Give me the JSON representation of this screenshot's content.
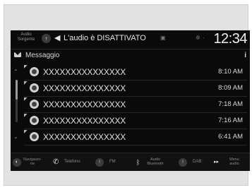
{
  "status_bar": {
    "source_label_line1": "Audio",
    "source_label_line2": "Sorgente",
    "audio_status": "L'audio è DISATTIVATO",
    "clock": "12:34"
  },
  "header": {
    "title": "Messaggio",
    "info_glyph": "i"
  },
  "messages": [
    {
      "text": "XXXXXXXXXXXXXXX",
      "time": "8:10 AM",
      "unread": true
    },
    {
      "text": "XXXXXXXXXXXXXXX",
      "time": "8:09 AM",
      "unread": true
    },
    {
      "text": "XXXXXXXXXXXXXXX",
      "time": "7:18 AM",
      "unread": true
    },
    {
      "text": "XXXXXXXXXXXXXXX",
      "time": "7:16 AM",
      "unread": true
    },
    {
      "text": "XXXXXXXXXXXXXXX",
      "time": "6:41 AM",
      "unread": true
    }
  ],
  "bottom_bar": {
    "nav_line1": "Navigazio-",
    "nav_line2": "ne",
    "phone": "Telefono",
    "fm": "FM",
    "bt_line1": "Audio",
    "bt_line2": "Bluetooth",
    "dab": "DAB",
    "menu_line1": "Menu",
    "menu_line2": "audio"
  },
  "icons": {
    "mail": "mail-icon",
    "speaker": "speaker-icon",
    "phone": "phone-icon",
    "bluetooth": "bluetooth-icon"
  },
  "colors": {
    "screen_bg": "#0a0a0a",
    "text": "#e0e0e0",
    "muted_text": "#8a8a8a",
    "frame_bg": "#e2e2e2"
  }
}
